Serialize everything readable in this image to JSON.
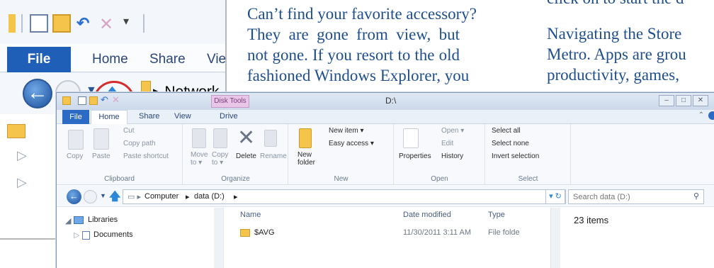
{
  "article": {
    "mid_lines": [
      "Can’t find your favorite accessory?",
      "They are gone from view, but",
      "not gone. If you resort to the old",
      "fashioned Windows Explorer, you"
    ],
    "right_top": "click on to start the d",
    "right_lines": [
      "Navigating the Store",
      "Metro. Apps are grou",
      "productivity, games,"
    ]
  },
  "inset": {
    "tabs": {
      "file": "File",
      "home": "Home",
      "share": "Share",
      "view": "Vie"
    },
    "back_glyph": "←",
    "dropdown_glyph": "▼",
    "up_glyph": "🡅",
    "crumb": "▸ Network",
    "highlight_color": "#d62b2b"
  },
  "explorer": {
    "title": "D:\\",
    "context_tab": "Disk Tools",
    "window_buttons": [
      "–",
      "□",
      "✕"
    ],
    "tabs": {
      "file": "File",
      "home": "Home",
      "share": "Share",
      "view": "View",
      "drive": "Drive"
    },
    "ribbon": {
      "clipboard": {
        "copy": "Copy",
        "paste": "Paste",
        "cut": "Cut",
        "copy_path": "Copy path",
        "paste_shortcut": "Paste shortcut",
        "label": "Clipboard"
      },
      "organize": {
        "move_to": "Move to ▾",
        "copy_to": "Copy to ▾",
        "delete": "Delete",
        "rename": "Rename",
        "label": "Organize"
      },
      "new": {
        "new_folder": "New folder",
        "new_item": "New item ▾",
        "easy_access": "Easy access ▾",
        "label": "New"
      },
      "open": {
        "properties": "Properties",
        "open": "Open ▾",
        "edit": "Edit",
        "history": "History",
        "label": "Open"
      },
      "select": {
        "select_all": "Select all",
        "select_none": "Select none",
        "invert": "Invert selection",
        "label": "Select"
      }
    },
    "address": {
      "path": [
        "Computer",
        "data (D:)"
      ],
      "search_placeholder": "Search data (D:)"
    },
    "nav": {
      "libraries": "Libraries",
      "documents": "Documents"
    },
    "columns": {
      "name": "Name",
      "date": "Date modified",
      "type": "Type"
    },
    "rows": [
      {
        "name": "$AVG",
        "date": "11/30/2011 3:11 AM",
        "type": "File folde"
      }
    ],
    "item_count": "23 items",
    "accent_color": "#2c6bc5"
  }
}
